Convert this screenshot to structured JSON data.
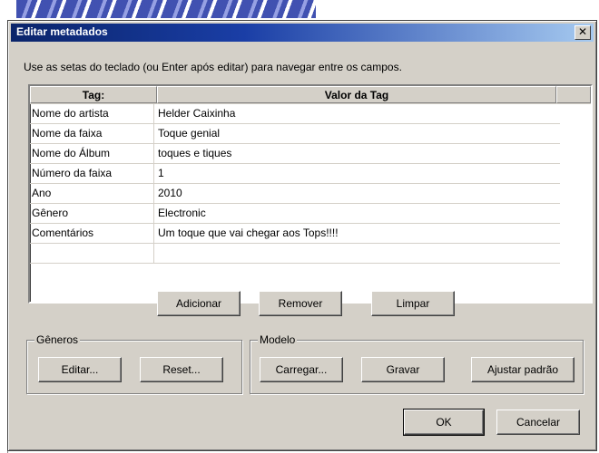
{
  "dialog": {
    "title": "Editar metadados",
    "close_glyph": "✕",
    "instructions": "Use as setas do teclado (ou Enter após editar) para navegar entre os campos."
  },
  "table": {
    "columns": [
      "Tag:",
      "Valor da Tag"
    ],
    "rows": [
      {
        "tag": "Nome do artista",
        "value": "Helder Caixinha"
      },
      {
        "tag": "Nome da faixa",
        "value": "Toque genial"
      },
      {
        "tag": "Nome do Álbum",
        "value": "toques e tiques"
      },
      {
        "tag": "Número da faixa",
        "value": "1"
      },
      {
        "tag": "Ano",
        "value": "2010"
      },
      {
        "tag": "Gênero",
        "value": "Electronic"
      },
      {
        "tag": "Comentários",
        "value": "Um toque que vai chegar aos Tops!!!!"
      },
      {
        "tag": "",
        "value": ""
      }
    ]
  },
  "actions": {
    "add": "Adicionar",
    "remove": "Remover",
    "clear": "Limpar"
  },
  "genres": {
    "label": "Gêneros",
    "edit": "Editar...",
    "reset": "Reset..."
  },
  "template": {
    "label": "Modelo",
    "load": "Carregar...",
    "save": "Gravar",
    "set_default": "Ajustar padrão"
  },
  "footer": {
    "ok": "OK",
    "cancel": "Cancelar"
  }
}
